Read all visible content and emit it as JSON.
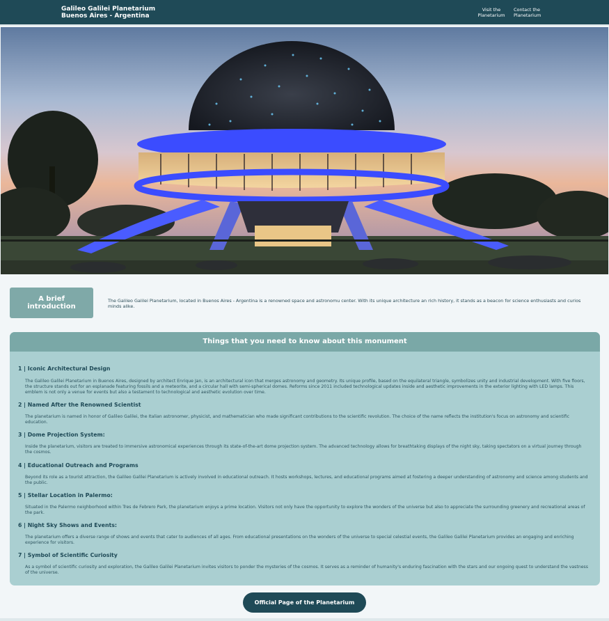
{
  "header": {
    "brand_line1": "Galileo Galilei Planetarium",
    "brand_line2": "Buenos Aires - Argentina",
    "nav": [
      {
        "line1": "Visit the",
        "line2": "Planetarium"
      },
      {
        "line1": "Contact the",
        "line2": "Planetarium"
      }
    ]
  },
  "intro": {
    "label_line1": "A brief",
    "label_line2": "introduction",
    "text": "The Galileo Galilei Planetarium, located in Buenos Aires - Argentina is a renowned space and astronomu center. With its unique architecture an rich history, it stands as a beacon for science enthusiasts and curios minds alike."
  },
  "things": {
    "heading": "Things that you need to know about this monument",
    "items": [
      {
        "title": "1 | Iconic Architectural Design",
        "text": "The Galileo Galilei Planetarium in Buenos Aires, designed by architect Enrique Jan, is an architectural icon that merges astronomy and geometry. Its unique profile, based on the equilateral triangle, symbolizes unity and industrial development. With five floors, the structure stands out for an esplanade featuring fossils and a meteorite, and a circular hall with semi-spherical domes. Reforms since 2011 included technological updates inside and aesthetic improvements in the exterior lighting with LED lamps. This emblem is not only a venue for events but also a testament to technological and aesthetic evolution over time."
      },
      {
        "title": "2 | Named After the Renowned Scientist",
        "text": "The planetarium is named in honor of Galileo Galilei, the Italian astronomer, physicist, and mathematician who made significant contributions to the scientific revolution. The choice of the name reflects the institution's focus on astronomy and scientific education."
      },
      {
        "title": "3 | Dome Projection System:",
        "text": "Inside the planetarium, visitors are treated to immersive astronomical experiences through its state-of-the-art dome projection system. The advanced technology allows for breathtaking displays of the night sky, taking spectators on a virtual journey through the cosmos."
      },
      {
        "title": "4 | Educational Outreach and Programs",
        "text": "Beyond its role as a tourist attraction, the Galileo Galilei Planetarium is actively involved in educational outreach. It hosts workshops, lectures, and educational programs aimed at fostering a deeper understanding of astronomy and science among students and the public."
      },
      {
        "title": "5 | Stellar Location in Palermo:",
        "text": "Situated in the Palermo neighborhood within Tres de Febrero Park, the planetarium enjoys a prime location. Visitors not only have the opportunity to explore the wonders of the universe but also to appreciate the surrounding greenery and recreational areas of the park."
      },
      {
        "title": "6 | Night Sky Shows and Events:",
        "text": "The planetarium offers a diverse range of shows and events that cater to audiences of all ages. From educational presentations on the wonders of the universe to special celestial events, the Galileo Galilei Planetarium provides an engaging and enriching experience for visitors."
      },
      {
        "title": "7 | Symbol of Scientific Curiosity",
        "text": "As a symbol of scientific curiosity and exploration, the Galileo Galilei Planetarium invites visitors to ponder the mysteries of the cosmos. It serves as a reminder of humanity's enduring fascination with the stars and our ongoing quest to understand the vastness of the universe."
      }
    ]
  },
  "cta": {
    "label": "Official Page of the Planetarium"
  },
  "colors": {
    "header": "#1f4a57",
    "panel": "#aacfd1",
    "panel_head": "#7aa8a7",
    "accent_blue": "#3a4bff"
  }
}
